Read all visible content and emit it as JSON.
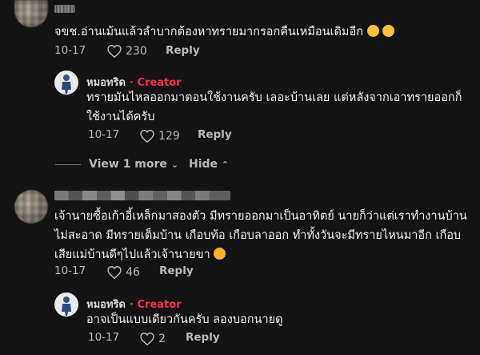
{
  "comments": [
    {
      "text": "จขช.อ่านเม้นแล้วลำบากต้องหาทรายมากรอกคืนเหมือนเดิมอีก",
      "date": "10-17",
      "likes": "230",
      "reply_label": "Reply",
      "emoji": [
        "laughing-emoji",
        "laughing-emoji"
      ]
    },
    {
      "text_line1": "เจ้านายซื้อเก้าอี้เหล็กมาสองตัว มีทรายออกมาเป็นอาทิตย์ นายก็ว่าแต่เราทำงานบ้าน",
      "text_line2": "ไม่สะอาด มีทรายเต็มบ้าน เกือบท้อ เกือบลาออก ทำทั้งวันจะมีทรายไหนมาอีก เกือบ",
      "text_line3": "เสียแม่บ้านดีๆไปแล้วเจ้านายขา",
      "date": "10-17",
      "likes": "46",
      "reply_label": "Reply",
      "emoji": [
        "worried-emoji"
      ]
    }
  ],
  "replies": [
    {
      "username": "หมอทริด",
      "badge": "· Creator",
      "text_line1": "ทรายมันไหลออกมาตอนใช้งานครับ เลอะบ้านเลย แต่หลังจากเอาทรายออกก็",
      "text_line2": "ใช้งานได้ครับ",
      "date": "10-17",
      "likes": "129",
      "reply_label": "Reply"
    },
    {
      "username": "หมอทริด",
      "badge": "· Creator",
      "text": "อาจเป็นแบบเดียวกันครับ ลองบอกนายดู",
      "date": "10-17",
      "likes": "2",
      "reply_label": "Reply"
    }
  ],
  "thread_controls": {
    "view_more": "View 1 more",
    "hide": "Hide"
  },
  "colors": {
    "background": "#131313",
    "creator_accent": "#fe2c55"
  }
}
